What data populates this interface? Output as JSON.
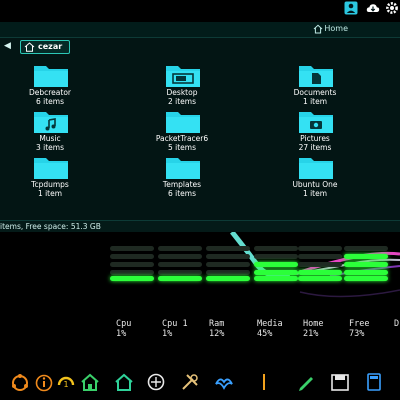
{
  "window": {
    "title": "Home"
  },
  "pathbar": {
    "current": "cezar"
  },
  "folders": [
    {
      "name": "Debcreator",
      "count": "6 items"
    },
    {
      "name": "Desktop",
      "count": "2 items"
    },
    {
      "name": "Documents",
      "count": "1 item"
    },
    {
      "name": "Music",
      "count": "3 items"
    },
    {
      "name": "PacketTracer6",
      "count": "5 items"
    },
    {
      "name": "Pictures",
      "count": "27 items"
    },
    {
      "name": "Tcpdumps",
      "count": "1 item"
    },
    {
      "name": "Templates",
      "count": "6 items"
    },
    {
      "name": "Ubuntu One",
      "count": "1 item"
    }
  ],
  "statusbar": {
    "text": "items, Free space: 51.3 GB"
  },
  "stats": [
    {
      "label": "Cpu",
      "value": "1%"
    },
    {
      "label": "Cpu 1",
      "value": "1%"
    },
    {
      "label": "Ram",
      "value": "12%"
    },
    {
      "label": "Media",
      "value": "45%"
    },
    {
      "label": "Home",
      "value": "21%"
    },
    {
      "label": "Free",
      "value": "73%"
    },
    {
      "label": "D",
      "value": ""
    }
  ],
  "colors": {
    "accent": "#2cc7b6",
    "folder": "#27d3e8",
    "meter_on": "#2cff3a"
  },
  "tray_icons": [
    "user-icon",
    "cloud-download-icon",
    "gear-icon"
  ],
  "dock_icons": [
    "ubuntu-icon",
    "info-icon",
    "ubuntu-one-icon",
    "home-folder-icon",
    "home-icon",
    "packet-tracer-icon",
    "tools-icon",
    "thunderbird-icon",
    "pen-icon",
    "pencil-icon",
    "folder-icon",
    "save-icon",
    "calculator-icon",
    "terminal-icon"
  ]
}
